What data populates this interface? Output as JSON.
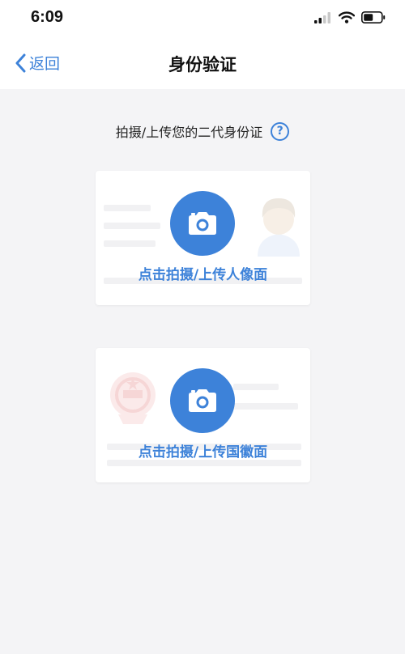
{
  "status_bar": {
    "time": "6:09"
  },
  "nav": {
    "back_label": "返回",
    "title": "身份验证"
  },
  "instruction": {
    "text": "拍摄/上传您的二代身份证",
    "help_symbol": "?"
  },
  "cards": {
    "front": {
      "label": "点击拍摄/上传人像面",
      "icon": "camera-icon"
    },
    "back": {
      "label": "点击拍摄/上传国徽面",
      "icon": "camera-icon"
    }
  },
  "colors": {
    "accent": "#3d82d9",
    "background": "#f4f4f6",
    "card": "#ffffff"
  }
}
